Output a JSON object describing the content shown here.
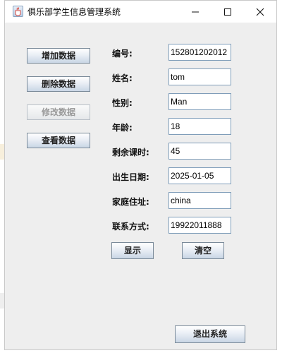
{
  "window": {
    "title": "俱乐部学生信息管理系统",
    "icon": "java-cup-icon",
    "controls": [
      "minimize-icon",
      "maximize-icon",
      "close-icon"
    ]
  },
  "actions": [
    {
      "id": "add",
      "label": "增加数据",
      "enabled": true
    },
    {
      "id": "delete",
      "label": "删除数据",
      "enabled": true
    },
    {
      "id": "modify",
      "label": "修改数据",
      "enabled": false
    },
    {
      "id": "view",
      "label": "查看数据",
      "enabled": true
    }
  ],
  "fields": [
    {
      "id": "number",
      "label": "编号:",
      "value": "152801202012"
    },
    {
      "id": "name",
      "label": "姓名:",
      "value": "tom"
    },
    {
      "id": "gender",
      "label": "性别:",
      "value": "Man"
    },
    {
      "id": "age",
      "label": "年龄:",
      "value": "18"
    },
    {
      "id": "remaining-hours",
      "label": "剩余课时:",
      "value": "45"
    },
    {
      "id": "birth-date",
      "label": "出生日期:",
      "value": "2025-01-05"
    },
    {
      "id": "address",
      "label": "家庭住址:",
      "value": "china"
    },
    {
      "id": "contact",
      "label": "联系方式:",
      "value": "19922011888"
    }
  ],
  "form_buttons": {
    "show": "显示",
    "clear": "清空"
  },
  "exit_button": "退出系统",
  "background": {
    "paren": ")"
  },
  "colors": {
    "window_bg": "#eeeeee",
    "input_border": "#7f9db9",
    "button_border": "#7a8a99"
  }
}
